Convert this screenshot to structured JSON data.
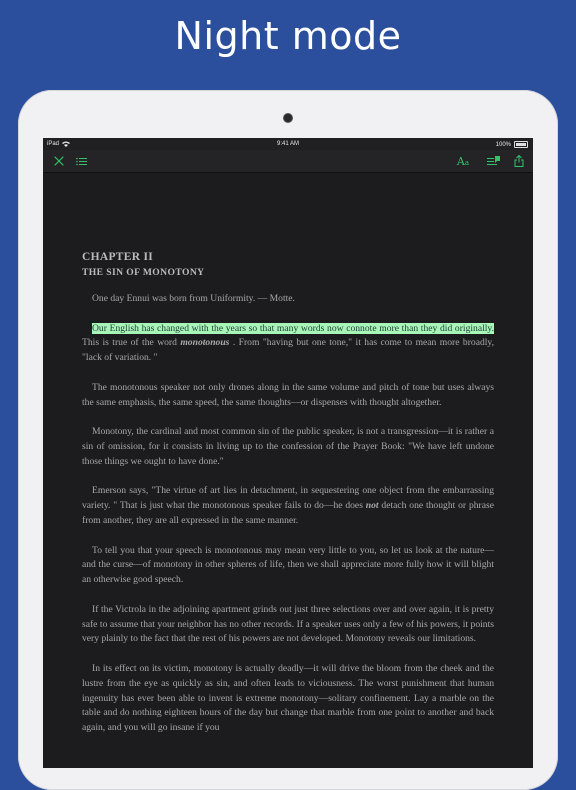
{
  "headline": "Night mode",
  "status": {
    "device": "iPad",
    "time": "9:41 AM",
    "battery": "100%"
  },
  "toolbar": {
    "font_label": "A",
    "font_label_small": "a"
  },
  "book": {
    "chapter": "CHAPTER II",
    "chapter_title": "THE SIN OF MONOTONY",
    "epigraph": "One day Ennui was born from Uniformity. — Motte.",
    "p1_highlight": "Our English has changed with the years so that many words now connote more than they did originally.",
    "p1_a": " This is true of the word ",
    "p1_em": "monotonous",
    "p1_b": " . From \"having but one tone,\" it has come to mean more broadly, \"lack of variation. \"",
    "p2": "The monotonous speaker not only drones along in the same volume and pitch of tone but uses always the same emphasis, the same speed, the same thoughts—or dispenses with thought altogether.",
    "p3": "Monotony, the cardinal and most common sin of the public speaker, is not a transgression—it is rather a sin of omission, for it consists in living up to the confession of the Prayer Book: \"We have left undone those things we ought to have done.\"",
    "p4_a": "Emerson says, \"The virtue of art lies in detachment, in sequestering one object from the embarrassing variety. \" That is just what the monotonous speaker fails to do—he does ",
    "p4_em": "not",
    "p4_b": " detach one thought or phrase from another, they are all expressed in the same manner.",
    "p5": "To tell you that your speech is monotonous may mean very little to you, so let us look at the nature—and the curse—of monotony in other spheres of life, then we shall appreciate more fully how it will blight an otherwise good speech.",
    "p6": "If the Victrola in the adjoining apartment grinds out just three selections over and over again, it is pretty safe to assume that your neighbor has no other records. If a speaker uses only a few of his powers, it points very plainly to the fact that the rest of his powers are not developed. Monotony reveals our limitations.",
    "p7": "In its effect on its victim, monotony is actually deadly—it will drive the bloom from the cheek and the lustre from the eye as quickly as sin, and often leads to viciousness. The worst punishment that human ingenuity has ever been able to invent is extreme monotony—solitary confinement. Lay a marble on the table and do nothing eighteen hours of the day but change that marble from one point to another and back again, and you will go insane if you"
  },
  "colors": {
    "background": "#2b4f9c",
    "accent": "#33c46a",
    "highlight": "#a8f5b8",
    "page": "#1c1c1e"
  },
  "icons": [
    "wifi-icon",
    "battery-icon",
    "close-icon",
    "list-icon",
    "font-size-icon",
    "notes-icon",
    "share-icon"
  ]
}
